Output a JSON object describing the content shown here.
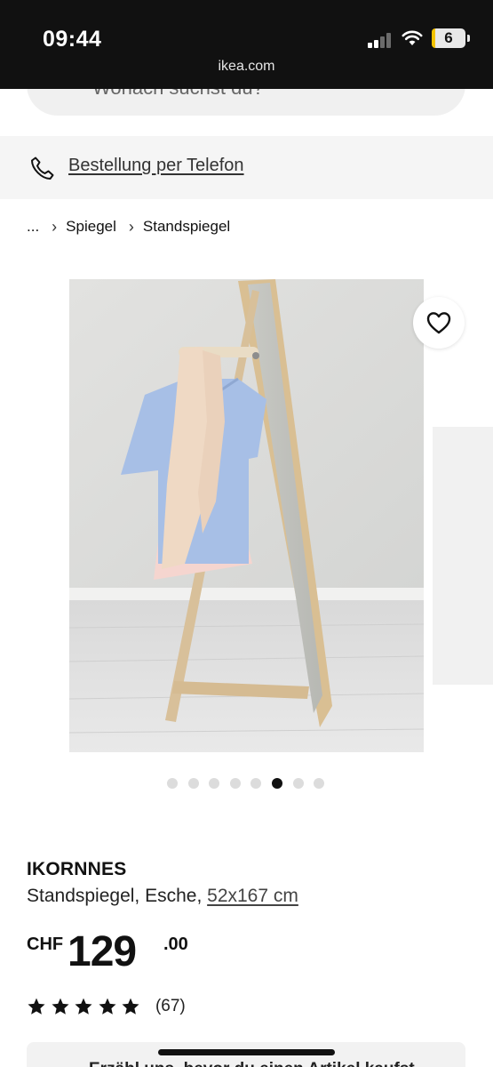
{
  "status_bar": {
    "time": "09:44",
    "url": "ikea.com",
    "battery": "6"
  },
  "search": {
    "placeholder": "Wonach suchst du?"
  },
  "phone_order": {
    "label": "Bestellung per Telefon"
  },
  "breadcrumb": {
    "items": [
      "...",
      "Spiegel",
      "Standspiegel"
    ]
  },
  "gallery": {
    "image_count": 8,
    "active_index": 5
  },
  "product": {
    "name": "IKORNNES",
    "description": "Standspiegel, Esche,",
    "size": "52x167 cm",
    "price_currency": "CHF",
    "price_integer": "129",
    "price_decimal": ".00",
    "rating_stars": 5,
    "rating_count": "(67)"
  },
  "bottom_banner": {
    "text": "Erzähl uns, bevor du einen Artikel kaufst"
  },
  "colors": {
    "status_bar": "#111111",
    "surface": "#f5f5f5",
    "text": "#111111",
    "battery_accent": "#f3c300"
  }
}
